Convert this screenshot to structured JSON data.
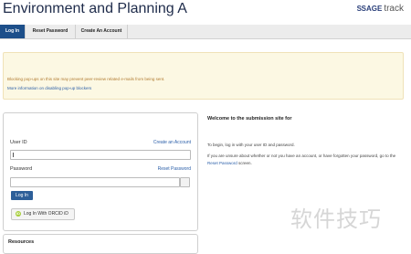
{
  "header": {
    "title": "Environment and Planning A",
    "logo_brand": "SAGE",
    "logo_product": "track"
  },
  "tabs": [
    {
      "label": "Log In",
      "active": true
    },
    {
      "label": "Reset Password",
      "active": false
    },
    {
      "label": "Create An Account",
      "active": false
    }
  ],
  "alert": {
    "message": "Blocking pop-ups on this site may prevent peer-review related e-mails from being sent.",
    "link": "More information on disabling pop-up blockers"
  },
  "login": {
    "user_label": "User ID",
    "create_link": "Create an Account",
    "password_label": "Password",
    "reset_link": "Reset Password",
    "login_button": "Log In",
    "orcid_button": "Log In With ORCID iD",
    "orcid_icon_text": "iD"
  },
  "resources": {
    "heading": "Resources"
  },
  "welcome": {
    "heading": "Welcome to the submission site for",
    "instruction": "To begin, log in with your user ID and password.",
    "unsure_pre": "If you are unsure about whether or not you have an account, or have forgotten your password, go to the",
    "unsure_link": "Reset Password",
    "unsure_post": "screen."
  },
  "watermark": "软件技巧",
  "colors": {
    "tab_active": "#1d4f8a",
    "link": "#2a5ea8",
    "alert_bg": "#fcf8e3",
    "alert_text": "#b07a30",
    "button": "#2d5f99",
    "orcid": "#a6ce39"
  }
}
